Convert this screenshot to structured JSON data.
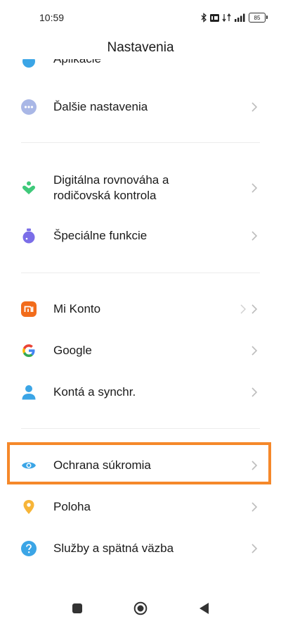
{
  "status_bar": {
    "time": "10:59",
    "battery": "85"
  },
  "header": {
    "title": "Nastavenia"
  },
  "cut_item": {
    "label": "Aplikácie"
  },
  "items": [
    {
      "label": "Ďalšie nastavenia",
      "icon": "more-dots-icon"
    },
    {
      "label_line1": "Digitálna rovnováha a",
      "label_line2": "rodičovská kontrola",
      "icon": "heart-person-icon"
    },
    {
      "label": "Špeciálne funkcie",
      "icon": "accessibility-icon"
    },
    {
      "label": "Mi Konto",
      "icon": "mi-logo-icon"
    },
    {
      "label": "Google",
      "icon": "google-icon"
    },
    {
      "label": "Kontá a synchr.",
      "icon": "person-icon"
    },
    {
      "label": "Ochrana súkromia",
      "icon": "eye-icon"
    },
    {
      "label": "Poloha",
      "icon": "location-pin-icon"
    },
    {
      "label": "Služby a spätná väzba",
      "icon": "help-icon"
    }
  ],
  "colors": {
    "highlight": "#f5882a",
    "accent_blue": "#3ba5e6",
    "mi_orange": "#f26c1b"
  }
}
